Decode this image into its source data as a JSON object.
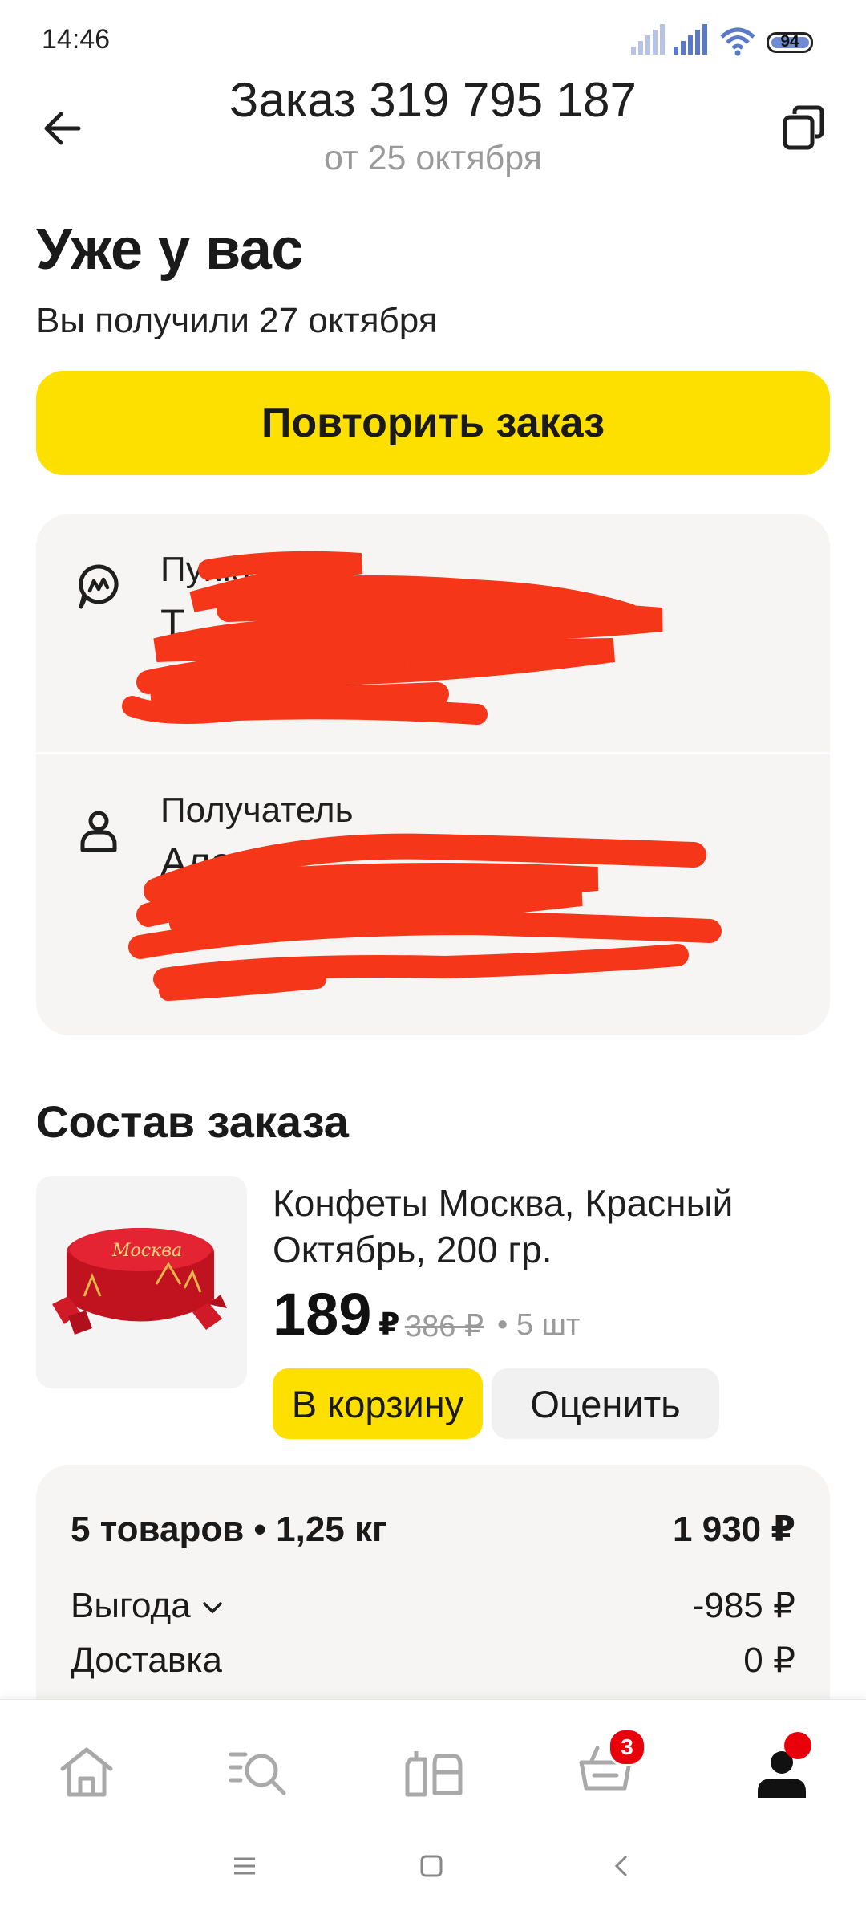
{
  "status_bar": {
    "time": "14:46",
    "battery": "94"
  },
  "header": {
    "title": "Заказ 319 795 187",
    "subtitle": "от 25 октября"
  },
  "status": {
    "title": "Уже у вас",
    "subtitle": "Вы получили 27 октября"
  },
  "repeat_button": "Повторить заказ",
  "pickup": {
    "label": "Пункт выд",
    "value_line1": "Т",
    "value_line2": "За"
  },
  "recipient": {
    "label": "Получатель",
    "value_line1": "Але",
    "value_line2": "+"
  },
  "section_title": "Состав заказа",
  "product": {
    "title": "Конфеты Москва, Красный Октябрь, 200 гр.",
    "price": "189",
    "currency": "₽",
    "old_price": "386 ₽",
    "quantity": "• 5 шт",
    "box_text": "Москва",
    "cart_button": "В корзину",
    "rate_button": "Оценить"
  },
  "summary": {
    "items_label": "5 товаров • 1,25 кг",
    "items_value": "1 930 ₽",
    "savings_label": "Выгода",
    "savings_value": "-985 ₽",
    "delivery_label": "Доставка",
    "delivery_value": "0 ₽"
  },
  "bottom_nav": {
    "cart_badge": "3"
  },
  "colors": {
    "accent": "#fde000",
    "redaction": "#f53619",
    "badge": "#e8000b"
  },
  "icons": [
    "back-arrow-icon",
    "copy-icon",
    "pickup-point-icon",
    "person-icon",
    "home-icon",
    "catalog-search-icon",
    "products-icon",
    "cart-icon",
    "profile-icon"
  ]
}
